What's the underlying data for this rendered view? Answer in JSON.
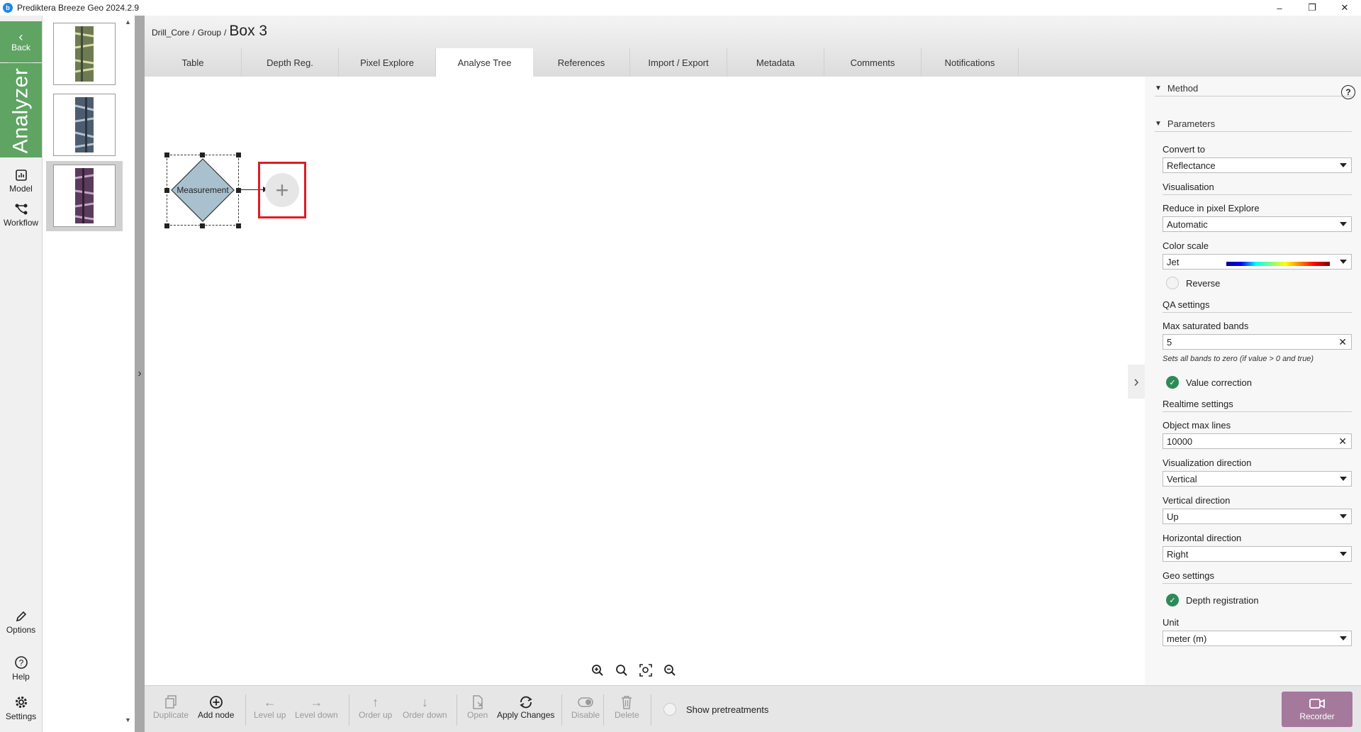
{
  "window": {
    "title": "Prediktera Breeze Geo 2024.2.9",
    "logo_letter": "b",
    "minimize": "–",
    "restore": "❐",
    "close": "✕"
  },
  "leftnav": {
    "back": "Back",
    "analyzer": "Analyzer",
    "model": "Model",
    "workflow": "Workflow",
    "options": "Options",
    "help": "Help",
    "settings": "Settings"
  },
  "breadcrumb": {
    "root": "Drill_Core",
    "sep": "/",
    "group": "Group",
    "current": "Box 3"
  },
  "tabs": [
    {
      "label": "Table"
    },
    {
      "label": "Depth Reg."
    },
    {
      "label": "Pixel Explore"
    },
    {
      "label": "Analyse Tree",
      "active": true
    },
    {
      "label": "References"
    },
    {
      "label": "Import / Export"
    },
    {
      "label": "Metadata"
    },
    {
      "label": "Comments"
    },
    {
      "label": "Notifications"
    }
  ],
  "canvas": {
    "node_label": "Measurement",
    "add_icon": "+"
  },
  "panel": {
    "method": "Method",
    "help_icon": "?",
    "parameters": "Parameters",
    "convert_to_label": "Convert to",
    "convert_to_value": "Reflectance",
    "visualisation": "Visualisation",
    "reduce_label": "Reduce in pixel Explore",
    "reduce_value": "Automatic",
    "color_scale_label": "Color scale",
    "color_scale_value": "Jet",
    "reverse": "Reverse",
    "qa_settings": "QA settings",
    "max_sat_label": "Max saturated bands",
    "max_sat_value": "5",
    "max_sat_hint": "Sets all bands to zero (if value > 0 and true)",
    "value_correction": "Value correction",
    "realtime_settings": "Realtime settings",
    "obj_max_lines_label": "Object max lines",
    "obj_max_lines_value": "10000",
    "vis_dir_label": "Visualization direction",
    "vis_dir_value": "Vertical",
    "vert_dir_label": "Vertical direction",
    "vert_dir_value": "Up",
    "horiz_dir_label": "Horizontal direction",
    "horiz_dir_value": "Right",
    "geo_settings": "Geo settings",
    "depth_registration": "Depth registration",
    "unit_label": "Unit",
    "unit_value": "meter (m)",
    "clear_icon": "✕"
  },
  "toolbar": {
    "duplicate": "Duplicate",
    "add_node": "Add node",
    "level_up": "Level up",
    "level_down": "Level down",
    "order_up": "Order up",
    "order_down": "Order down",
    "open": "Open",
    "apply_changes": "Apply Changes",
    "disable": "Disable",
    "delete": "Delete",
    "show_pretreatments": "Show pretreatments",
    "recorder": "Recorder"
  },
  "colors": {
    "accent_green": "#5fa463",
    "recorder": "#a5799c",
    "highlight_red": "#e01b24",
    "node_fill": "#a9c1cf"
  }
}
